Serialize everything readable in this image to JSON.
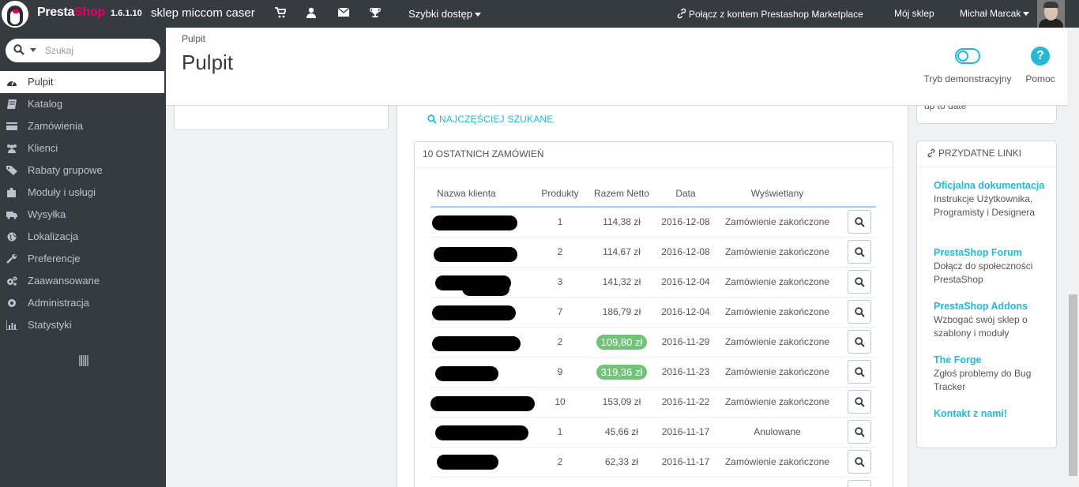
{
  "topbar": {
    "brand_presta": "Presta",
    "brand_shop": "Shop",
    "version": "1.6.1.10",
    "shop_name": "sklep miccom caser",
    "quick_access": "Szybki dostęp",
    "marketplace": "Połącz z kontem Prestashop Marketplace",
    "my_shop": "Mój sklep",
    "user": "Michał Marcak"
  },
  "search": {
    "placeholder": "Szukaj"
  },
  "sidebar": {
    "items": [
      {
        "label": "Pulpit",
        "icon": "dashboard-icon"
      },
      {
        "label": "Katalog",
        "icon": "book-icon"
      },
      {
        "label": "Zamówienia",
        "icon": "credit-card-icon"
      },
      {
        "label": "Klienci",
        "icon": "users-icon"
      },
      {
        "label": "Rabaty grupowe",
        "icon": "tag-icon"
      },
      {
        "label": "Moduły i usługi",
        "icon": "puzzle-icon"
      },
      {
        "label": "Wysyłka",
        "icon": "truck-icon"
      },
      {
        "label": "Lokalizacja",
        "icon": "globe-icon"
      },
      {
        "label": "Preferencje",
        "icon": "wrench-icon"
      },
      {
        "label": "Zaawansowane",
        "icon": "cogs-icon"
      },
      {
        "label": "Administracja",
        "icon": "gear-icon"
      },
      {
        "label": "Statystyki",
        "icon": "bar-chart-icon"
      }
    ]
  },
  "header": {
    "breadcrumb": "Pulpit",
    "title": "Pulpit",
    "demo_mode": "Tryb demonstracyjny",
    "help": "Pomoc"
  },
  "main": {
    "most_searched": "NAJCZĘŚCIEJ SZUKANE",
    "orders_title": "10 OSTATNICH ZAMÓWIEŃ",
    "columns": [
      "Nazwa klienta",
      "Produkty",
      "Razem Netto",
      "Data",
      "Wyświetlany"
    ],
    "orders": [
      {
        "products": "1",
        "total": "114,38 zł",
        "highlight": false,
        "date": "2016-12-08",
        "status": "Zamówienie zakończone"
      },
      {
        "products": "2",
        "total": "114,67 zł",
        "highlight": false,
        "date": "2016-12-08",
        "status": "Zamówienie zakończone"
      },
      {
        "products": "3",
        "total": "141,32 zł",
        "highlight": false,
        "date": "2016-12-04",
        "status": "Zamówienie zakończone"
      },
      {
        "products": "7",
        "total": "186,79 zł",
        "highlight": false,
        "date": "2016-12-04",
        "status": "Zamówienie zakończone"
      },
      {
        "products": "2",
        "total": "109,80 zł",
        "highlight": true,
        "date": "2016-11-29",
        "status": "Zamówienie zakończone"
      },
      {
        "products": "9",
        "total": "319,36 zł",
        "highlight": true,
        "date": "2016-11-23",
        "status": "Zamówienie zakończone"
      },
      {
        "products": "10",
        "total": "153,09 zł",
        "highlight": false,
        "date": "2016-11-22",
        "status": "Zamówienie zakończone"
      },
      {
        "products": "1",
        "total": "45,66 zł",
        "highlight": false,
        "date": "2016-11-17",
        "status": "Anulowane"
      },
      {
        "products": "2",
        "total": "62,33 zł",
        "highlight": false,
        "date": "2016-11-17",
        "status": "Zamówienie zakończone"
      }
    ]
  },
  "useful_links": {
    "title": "PRZYDATNE LINKI",
    "items": [
      {
        "title": "Oficjalna dokumentacja",
        "desc": "Instrukcje Użytkownika, Programisty i Designera"
      },
      {
        "title": "PrestaShop Forum",
        "desc": "Dołącz do społeczności PrestaShop"
      },
      {
        "title": "PrestaShop Addons",
        "desc": "Wzbogać swój sklep o szablony i moduły"
      },
      {
        "title": "The Forge",
        "desc": "Zgłoś problemy do Bug Tracker"
      },
      {
        "title": "Kontakt z nami!",
        "desc": ""
      }
    ]
  },
  "colors": {
    "accent": "#25b9d7",
    "brand_pink": "#df0067",
    "sidebar_bg": "#363a41",
    "success": "#72c279"
  }
}
